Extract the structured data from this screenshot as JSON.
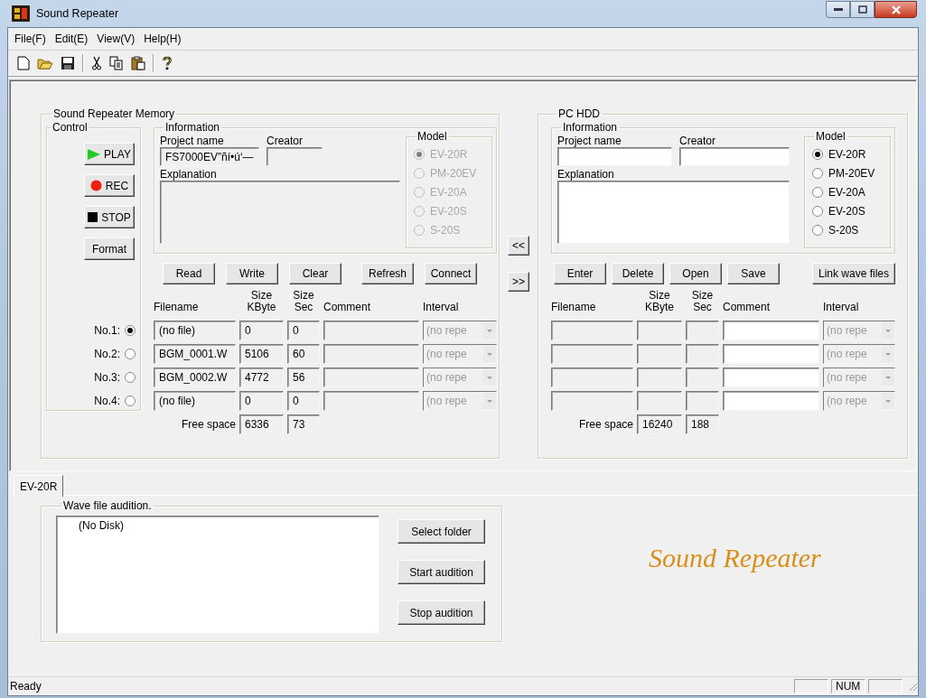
{
  "window": {
    "title": "Sound Repeater"
  },
  "menu": [
    {
      "label": "File(F)"
    },
    {
      "label": "Edit(E)"
    },
    {
      "label": "View(V)"
    },
    {
      "label": "Help(H)"
    }
  ],
  "sections": [
    {
      "title": "Sound Repeater Memory",
      "control": {
        "title": "Control",
        "buttons": [
          {
            "kind": "play",
            "label": "PLAY"
          },
          {
            "kind": "rec",
            "label": "REC"
          },
          {
            "kind": "stop",
            "label": "STOP"
          },
          {
            "kind": "plain",
            "label": "Format"
          }
        ]
      },
      "information": {
        "title": "Information",
        "disabled": true,
        "project_label": "Project name",
        "project_value": "FS7000EV”ñí•ú‘—",
        "creator_label": "Creator",
        "explanation_label": "Explanation",
        "model_title": "Model",
        "models": [
          {
            "label": "EV-20R",
            "selected": true
          },
          {
            "label": "PM-20EV",
            "selected": false
          },
          {
            "label": "EV-20A",
            "selected": false
          },
          {
            "label": "EV-20S",
            "selected": false
          },
          {
            "label": "S-20S",
            "selected": false
          }
        ]
      },
      "actions": [
        "Read",
        "Write",
        "Clear",
        "Refresh",
        "Connect"
      ],
      "columns": [
        {
          "lines": [
            "Filename"
          ]
        },
        {
          "lines": [
            "Size",
            "KByte"
          ]
        },
        {
          "lines": [
            "Size",
            "Sec"
          ]
        },
        {
          "lines": [
            "Comment"
          ]
        },
        {
          "lines": [
            "Interval"
          ]
        }
      ],
      "rows": [
        {
          "label": "No.1:",
          "selected": true,
          "filename": "(no file)",
          "size_kbyte": "0",
          "size_sec": "0",
          "interval": "(no repe"
        },
        {
          "label": "No.2:",
          "selected": false,
          "filename": "BGM_0001.W",
          "size_kbyte": "5106",
          "size_sec": "60",
          "interval": "(no repe"
        },
        {
          "label": "No.3:",
          "selected": false,
          "filename": "BGM_0002.W",
          "size_kbyte": "4772",
          "size_sec": "56",
          "interval": "(no repe"
        },
        {
          "label": "No.4:",
          "selected": false,
          "filename": "(no file)",
          "size_kbyte": "0",
          "size_sec": "0",
          "interval": "(no repe"
        }
      ],
      "free_space": {
        "label": "Free space",
        "size_kbyte": "6336",
        "size_sec": "73"
      }
    },
    {
      "title": "PC HDD",
      "information": {
        "title": "Information",
        "disabled": false,
        "project_label": "Project name",
        "creator_label": "Creator",
        "explanation_label": "Explanation",
        "model_title": "Model",
        "models": [
          {
            "label": "EV-20R",
            "selected": true
          },
          {
            "label": "PM-20EV",
            "selected": false
          },
          {
            "label": "EV-20A",
            "selected": false
          },
          {
            "label": "EV-20S",
            "selected": false
          },
          {
            "label": "S-20S",
            "selected": false
          }
        ]
      },
      "actions": [
        "Enter",
        "Delete",
        "Open",
        "Save",
        "Link wave files"
      ],
      "columns": [
        {
          "lines": [
            "Filename"
          ]
        },
        {
          "lines": [
            "Size",
            "KByte"
          ]
        },
        {
          "lines": [
            "Size",
            "Sec"
          ]
        },
        {
          "lines": [
            "Comment"
          ]
        },
        {
          "lines": [
            "Interval"
          ]
        }
      ],
      "rows": [
        {
          "interval": "(no repe"
        },
        {
          "interval": "(no repe"
        },
        {
          "interval": "(no repe"
        },
        {
          "interval": "(no repe"
        }
      ],
      "free_space": {
        "label": "Free space",
        "size_kbyte": "16240",
        "size_sec": "188"
      }
    }
  ],
  "transfer_buttons": [
    "<<",
    ">>"
  ],
  "tabs": [
    {
      "label": "EV-20R",
      "selected": true
    }
  ],
  "audition": {
    "title": "Wave file audition.",
    "items": [
      "(No Disk)"
    ],
    "buttons": [
      "Select folder",
      "Start audition",
      "Stop audition"
    ]
  },
  "logo_text": "Sound Repeater",
  "status_bar": {
    "text": "Ready",
    "indicators": [
      "NUM"
    ]
  }
}
